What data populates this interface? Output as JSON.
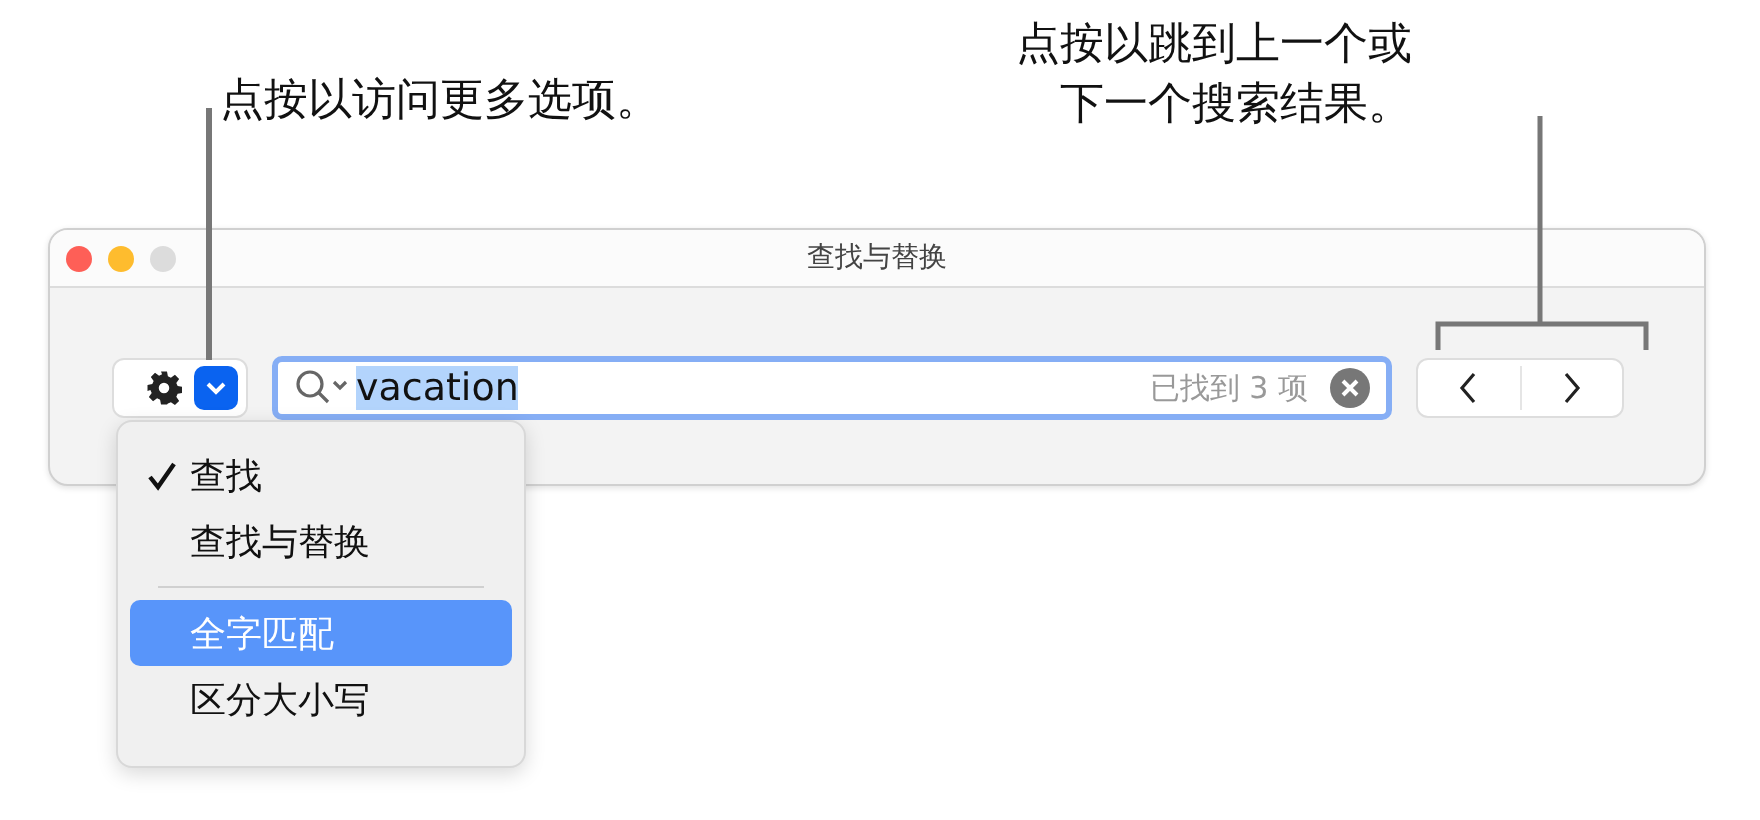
{
  "callouts": [
    {
      "lines": [
        "点按以访问更多选项。"
      ]
    },
    {
      "lines": [
        "点按以跳到上一个或",
        "下一个搜索结果。"
      ]
    }
  ],
  "window": {
    "title": "查找与替换"
  },
  "search": {
    "value": "vacation",
    "result": "已找到 3 项"
  },
  "menu": {
    "sections": [
      [
        {
          "label": "查找",
          "checked": true,
          "selected": false
        },
        {
          "label": "查找与替换",
          "checked": false,
          "selected": false
        }
      ],
      [
        {
          "label": "全字匹配",
          "checked": false,
          "selected": true
        },
        {
          "label": "区分大小写",
          "checked": false,
          "selected": false
        }
      ]
    ]
  }
}
